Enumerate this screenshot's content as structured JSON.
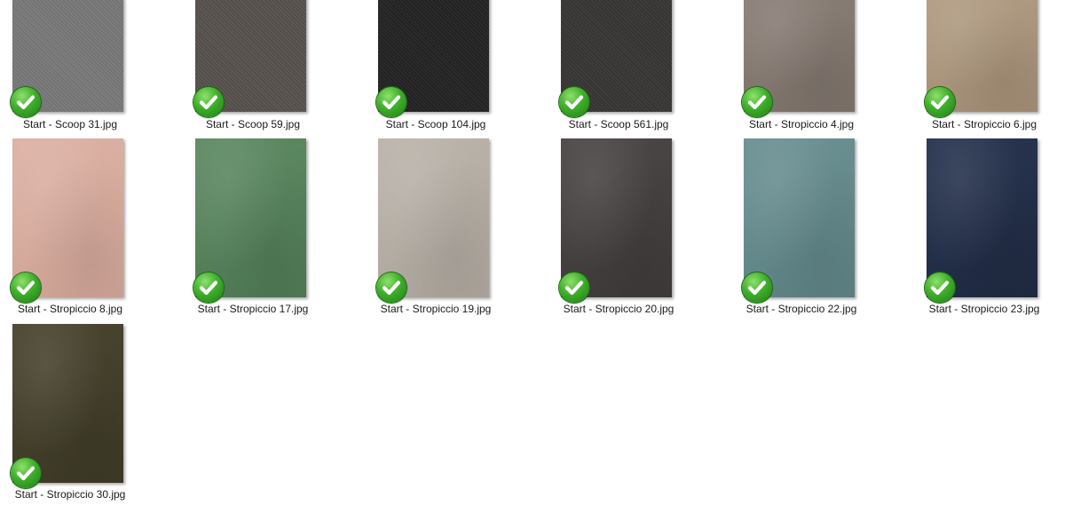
{
  "files": [
    {
      "name": "Start - Scoop 31.jpg",
      "color": "#7d7d7d",
      "dark": "#6f6f6f",
      "texture": "herringbone"
    },
    {
      "name": "Start - Scoop 59.jpg",
      "color": "#5e5854",
      "dark": "#4e4945",
      "texture": "herringbone"
    },
    {
      "name": "Start - Scoop 104.jpg",
      "color": "#2b2b2b",
      "dark": "#1e1e1e",
      "texture": "herringbone"
    },
    {
      "name": "Start - Scoop 561.jpg",
      "color": "#3f3d3b",
      "dark": "#323030",
      "texture": "herringbone"
    },
    {
      "name": "Start - Stropiccio 4.jpg",
      "color": "#8a7f77",
      "dark": "#7c726a",
      "texture": "velvet"
    },
    {
      "name": "Start - Stropiccio 6.jpg",
      "color": "#b29d84",
      "dark": "#a28d75",
      "texture": "velvet"
    },
    {
      "name": "Start - Stropiccio 8.jpg",
      "color": "#ddb2a4",
      "dark": "#cfa496",
      "texture": "velvet"
    },
    {
      "name": "Start - Stropiccio 17.jpg",
      "color": "#5e8a63",
      "dark": "#4f7954",
      "texture": "velvet"
    },
    {
      "name": "Start - Stropiccio 19.jpg",
      "color": "#bbb4ab",
      "dark": "#ada69d",
      "texture": "velvet"
    },
    {
      "name": "Start - Stropiccio 20.jpg",
      "color": "#4b4747",
      "dark": "#3e3a3a",
      "texture": "velvet"
    },
    {
      "name": "Start - Stropiccio 22.jpg",
      "color": "#6c9193",
      "dark": "#5d8284",
      "texture": "velvet"
    },
    {
      "name": "Start - Stropiccio 23.jpg",
      "color": "#283550",
      "dark": "#1f2a42",
      "texture": "velvet"
    },
    {
      "name": "Start - Stropiccio 30.jpg",
      "color": "#4a4530",
      "dark": "#3d3926",
      "texture": "velvet"
    }
  ],
  "status_icon": "green-check-icon"
}
